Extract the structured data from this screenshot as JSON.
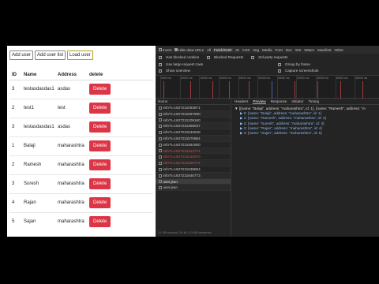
{
  "app": {
    "buttons": [
      "Add user",
      "Add user list",
      "Load user"
    ],
    "columns": [
      "ID",
      "Name",
      "Address",
      "delete"
    ],
    "rows": [
      {
        "id": "3",
        "name": "testasdasdas1",
        "address": "asdas",
        "action": "Delete"
      },
      {
        "id": "2",
        "name": "test1",
        "address": "test",
        "action": "Delete"
      },
      {
        "id": "3",
        "name": "testasdasdas1",
        "address": "asdas",
        "action": "Delete"
      },
      {
        "id": "1",
        "name": "Balaji",
        "address": "maharashtra",
        "action": "Delete"
      },
      {
        "id": "2",
        "name": "Ramesh",
        "address": "maharashtra",
        "action": "Delete"
      },
      {
        "id": "3",
        "name": "Suresh",
        "address": "maharashtra",
        "action": "Delete"
      },
      {
        "id": "4",
        "name": "Rajan",
        "address": "maharashtra",
        "action": "Delete"
      },
      {
        "id": "5",
        "name": "Sajan",
        "address": "maharashtra",
        "action": "Delete"
      }
    ],
    "delete_color": "#dc3545"
  },
  "devtools": {
    "filters": {
      "invert": "Invert",
      "hide_data_urls": "Hide data URLs",
      "types": [
        "All",
        "Fetch/XHR",
        "JS",
        "CSS",
        "Img",
        "Media",
        "Font",
        "Doc",
        "WS",
        "Wasm",
        "Manifest",
        "Other"
      ],
      "selected_type": "Fetch/XHR"
    },
    "options_row1": [
      "Has blocked cookies",
      "Blocked Requests",
      "3rd-party requests"
    ],
    "options_row2": [
      "Use large request rows",
      "Group by frame"
    ],
    "options_row3": [
      "Show overview",
      "Capture screenshots"
    ],
    "timeline_ticks": [
      "5000 ms",
      "10000 ms",
      "15000 ms",
      "20000 ms",
      "25000 ms",
      "30000 ms",
      "35000 ms",
      "40000 ms",
      "45000 ms",
      "50000 ms",
      "55000 ms"
    ],
    "name_header": "Name",
    "requests": [
      {
        "name": "info?t=1637231063871",
        "style": "normal"
      },
      {
        "name": "info?t=1637231097950",
        "style": "normal"
      },
      {
        "name": "info?t=1637231209160",
        "style": "normal"
      },
      {
        "name": "info?t=1637231258037",
        "style": "normal"
      },
      {
        "name": "info?t=1637231540848",
        "style": "normal"
      },
      {
        "name": "info?t=1637231570864",
        "style": "normal"
      },
      {
        "name": "info?t=1637231591800",
        "style": "normal"
      },
      {
        "name": "info?t=1637231612774",
        "style": "err"
      },
      {
        "name": "info?t=1637231618370",
        "style": "err"
      },
      {
        "name": "info?t=1637231628774",
        "style": "err"
      },
      {
        "name": "info?t=1637231638864",
        "style": "normal"
      },
      {
        "name": "info?t=1637231646773",
        "style": "normal"
      },
      {
        "name": "user.json",
        "style": "sel"
      },
      {
        "name": "user.json",
        "style": "normal"
      }
    ],
    "status_text": "14 / 88 requests | 5.6 kB / 4.5 MB transferred",
    "tabs": [
      "Headers",
      "Preview",
      "Response",
      "Initiator",
      "Timing"
    ],
    "active_tab": "Preview",
    "preview_summary": "▼ [{name: \"Balaji\", address: \"maharashtra\", id: 1}, {name: \"Ramesh\", address: \"m",
    "preview_items": [
      "▶ 0: {name: \"Balaji\", address: \"maharashtra\", id: 1}",
      "▶ 1: {name: \"Ramesh\", address: \"maharashtra\", id: 2}",
      "▶ 2: {name: \"Suresh\", address: \"maharashtra\", id: 3}",
      "▶ 3: {name: \"Rajan\", address: \"maharashtra\", id: 4}",
      "▶ 4: {name: \"Sajan\", address: \"maharashtra\", id: 5}"
    ]
  }
}
